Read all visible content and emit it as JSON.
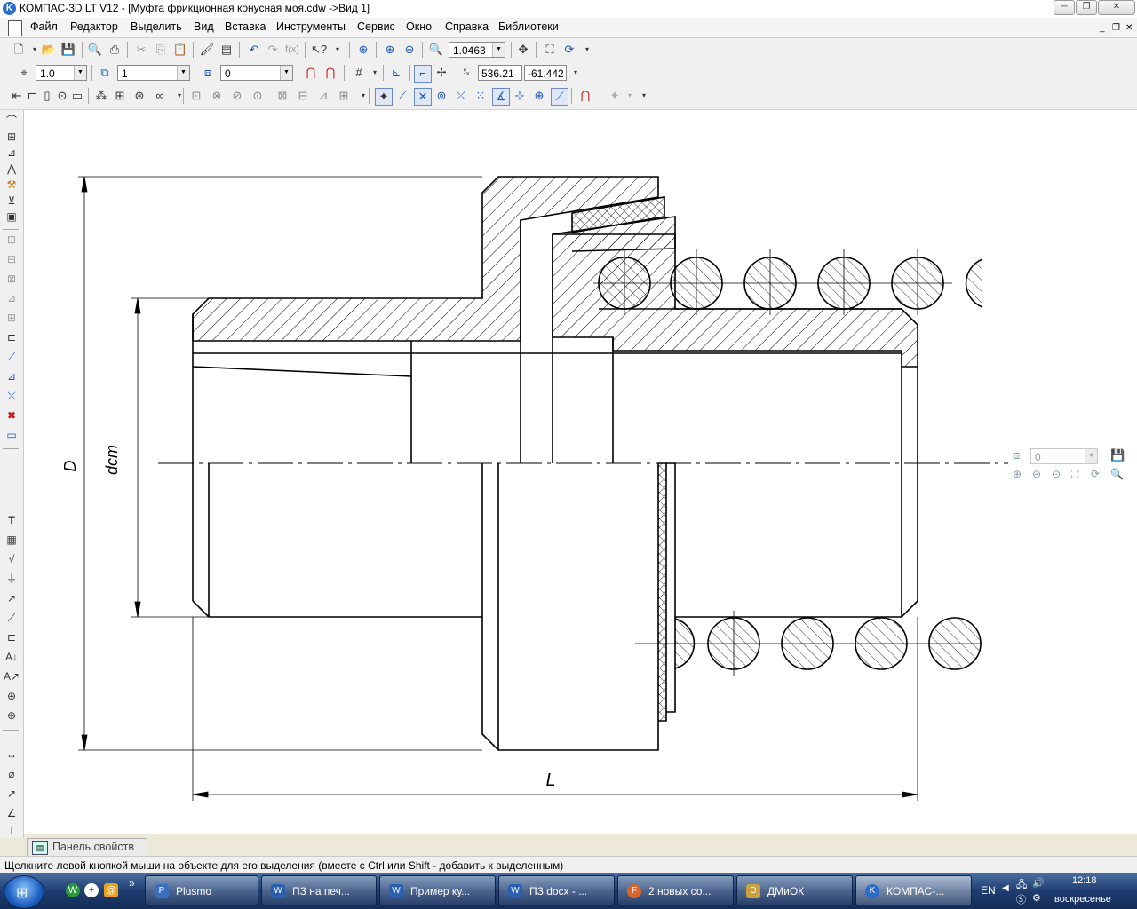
{
  "window": {
    "title": "КОМПАС-3D LT V12 - [Муфта фрикционная конусная моя.cdw ->Вид 1]",
    "app_icon": "K",
    "minimize": "─",
    "restore": "❐",
    "close": "✕"
  },
  "menubar": {
    "items": [
      "Файл",
      "Редактор",
      "Выделить",
      "Вид",
      "Вставка",
      "Инструменты",
      "Сервис",
      "Окно",
      "Справка",
      "Библиотеки"
    ],
    "mdi_minimize": "_",
    "mdi_restore": "❐",
    "mdi_close": "✕"
  },
  "toolbar_standard": {
    "zoom_value": "1.0463"
  },
  "toolbar_current_state": {
    "step_value": "1.0",
    "view_value": "1",
    "layer_value": "0",
    "cursor_x": "536.21",
    "cursor_y": "-61.442"
  },
  "drawing": {
    "dim_D": "D",
    "dim_dcm": "dcm",
    "dim_L": "L"
  },
  "layer_mini_panel": {
    "value": "0"
  },
  "property_panel": {
    "tab_label": "Панель свойств"
  },
  "status": {
    "text": "Щелкните левой кнопкой мыши на объекте для его выделения (вместе с Ctrl или Shift - добавить к выделенным)"
  },
  "taskbar": {
    "tasks": [
      {
        "label": "Plusmo",
        "icon": "P",
        "color": "#3a6fc0"
      },
      {
        "label": "ПЗ на печ...",
        "icon": "W",
        "color": "#2b5fb0"
      },
      {
        "label": "Пример ку...",
        "icon": "W",
        "color": "#2b5fb0"
      },
      {
        "label": "ПЗ.docx - ...",
        "icon": "W",
        "color": "#2b5fb0"
      },
      {
        "label": "2 новых со...",
        "icon": "F",
        "color": "#d8662a"
      },
      {
        "label": "ДМиОК",
        "icon": "D",
        "color": "#c8a040"
      },
      {
        "label": "КОМПАС-...",
        "icon": "K",
        "color": "#2a6cc8"
      }
    ],
    "language": "EN",
    "time": "12:18",
    "day": "воскресенье",
    "quicklaunch_more": "»"
  }
}
